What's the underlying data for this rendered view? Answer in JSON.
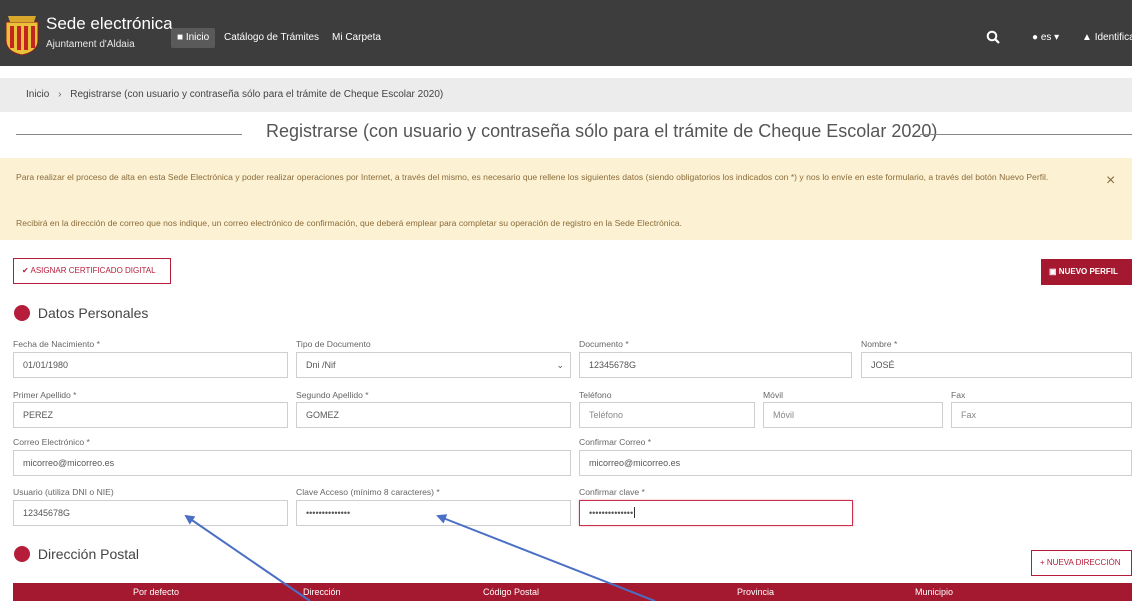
{
  "header": {
    "title": "Sede electrónica",
    "subtitle": "Ajuntament d'Aldaia",
    "nav": [
      "Inicio",
      "Catálogo de Trámites",
      "Mi Carpeta"
    ],
    "lang": "es",
    "login": "Identifica"
  },
  "breadcrumb": {
    "home": "Inicio",
    "current": "Registrarse (con usuario y contraseña sólo para el trámite de Cheque Escolar 2020)"
  },
  "page_title": "Registrarse (con usuario y contraseña sólo para el trámite de Cheque Escolar 2020)",
  "alert": {
    "p1": "Para realizar el proceso de alta en esta Sede Electrónica y poder realizar operaciones por Internet, a través del mismo, es necesario que rellene los siguientes datos (siendo obligatorios los indicados con *) y nos lo envíe en este formulario, a través del botón Nuevo Perfil.",
    "p2": "Recibirá en la dirección de correo que nos indique, un correo electrónico de confirmación, que deberá emplear para completar su operación de registro en la Sede Electrónica.",
    "close": "×"
  },
  "buttons": {
    "cert": "ASIGNAR CERTIFICADO DIGITAL",
    "new_profile": "NUEVO PERFIL",
    "new_address": "NUEVA DIRECCIÓN"
  },
  "sections": {
    "personal": "Datos Personales",
    "address": "Dirección Postal"
  },
  "form": {
    "birth": {
      "label": "Fecha de Nacimiento *",
      "value": "01/01/1980"
    },
    "doc_type": {
      "label": "Tipo de Documento",
      "value": "Dni /Nif"
    },
    "doc": {
      "label": "Documento *",
      "value": "12345678G"
    },
    "name": {
      "label": "Nombre *",
      "value": "JOSÉ"
    },
    "surname1": {
      "label": "Primer Apellido *",
      "value": "PEREZ"
    },
    "surname2": {
      "label": "Segundo Apellido *",
      "value": "GOMEZ"
    },
    "phone": {
      "label": "Teléfono",
      "placeholder": "Teléfono"
    },
    "mobile": {
      "label": "Móvil",
      "placeholder": "Móvil"
    },
    "fax": {
      "label": "Fax",
      "placeholder": "Fax"
    },
    "email": {
      "label": "Correo Electrónico *",
      "value": "micorreo@micorreo.es"
    },
    "email_confirm": {
      "label": "Confirmar Correo *",
      "value": "micorreo@micorreo.es"
    },
    "user": {
      "label": "Usuario (utiliza DNI o NIE)",
      "value": "12345678G"
    },
    "password": {
      "label": "Clave Acceso (mínimo 8 caracteres) *",
      "value": "••••••••••••••"
    },
    "password_confirm": {
      "label": "Confirmar clave *",
      "value": "••••••••••••••"
    }
  },
  "table": {
    "columns": [
      "Por defecto",
      "Dirección",
      "Código Postal",
      "Provincia",
      "Municipio"
    ]
  },
  "colors": {
    "navbar": "#3d3d3d",
    "accent": "#a4192f",
    "alert_bg": "#fcf1d3",
    "arrow": "#4a6fc4"
  }
}
